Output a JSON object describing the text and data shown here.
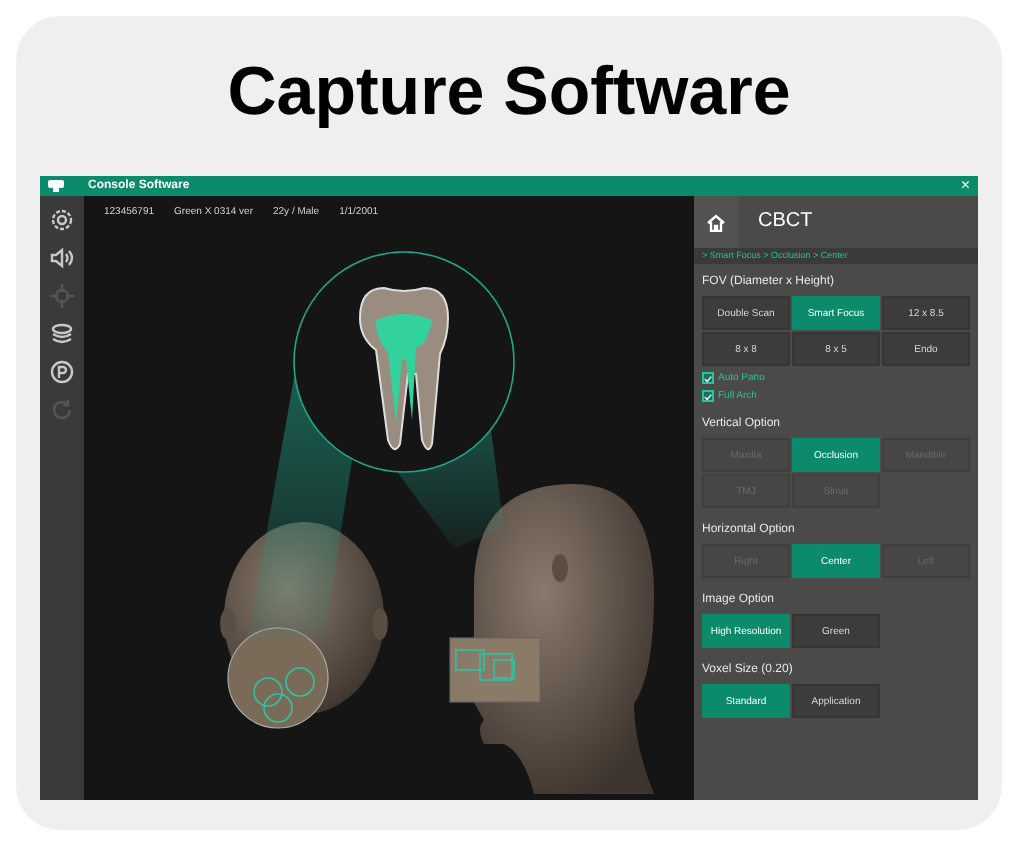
{
  "heading": "Capture Software",
  "window": {
    "title": "Console Software",
    "close": "×"
  },
  "toolbar": [
    {
      "kind": "gear",
      "disabled": false
    },
    {
      "kind": "speaker",
      "disabled": false
    },
    {
      "kind": "cross",
      "disabled": true
    },
    {
      "kind": "layers",
      "disabled": false
    },
    {
      "kind": "parking",
      "disabled": false
    },
    {
      "kind": "rotate",
      "disabled": true
    }
  ],
  "patient_info": [
    "123456791",
    "Green X 0314 ver",
    "22y / Male",
    "1/1/2001"
  ],
  "panel": {
    "title": "CBCT",
    "breadcrumb": "> Smart Focus > Occlusion > Center",
    "sections": [
      {
        "title": "FOV (Diameter x Height)",
        "buttons": [
          {
            "label": "Double Scan",
            "selected": false,
            "disabled": false
          },
          {
            "label": "Smart Focus",
            "selected": true,
            "disabled": false
          },
          {
            "label": "12 x 8.5",
            "selected": false,
            "disabled": false
          },
          {
            "label": "8 x 8",
            "selected": false,
            "disabled": false
          },
          {
            "label": "8 x 5",
            "selected": false,
            "disabled": false
          },
          {
            "label": "Endo",
            "selected": false,
            "disabled": false
          }
        ],
        "checkboxes": [
          {
            "label": "Auto Pano",
            "checked": true
          },
          {
            "label": "Full Arch",
            "checked": true
          }
        ]
      },
      {
        "title": "Vertical Option",
        "buttons": [
          {
            "label": "Maxilla",
            "selected": false,
            "disabled": true
          },
          {
            "label": "Occlusion",
            "selected": true,
            "disabled": false
          },
          {
            "label": "Mandible",
            "selected": false,
            "disabled": true
          },
          {
            "label": "TMJ",
            "selected": false,
            "disabled": true
          },
          {
            "label": "Sinus",
            "selected": false,
            "disabled": true
          }
        ]
      },
      {
        "title": "Horizontal Option",
        "buttons": [
          {
            "label": "Right",
            "selected": false,
            "disabled": true
          },
          {
            "label": "Center",
            "selected": true,
            "disabled": false
          },
          {
            "label": "Left",
            "selected": false,
            "disabled": true
          }
        ]
      },
      {
        "title": "Image Option",
        "buttons": [
          {
            "label": "High Resolution",
            "selected": true,
            "disabled": false
          },
          {
            "label": "Green",
            "selected": false,
            "disabled": false
          }
        ]
      },
      {
        "title": "Voxel Size (0.20)",
        "buttons": [
          {
            "label": "Standard",
            "selected": true,
            "disabled": false
          },
          {
            "label": "Application",
            "selected": false,
            "disabled": false
          }
        ]
      }
    ]
  }
}
